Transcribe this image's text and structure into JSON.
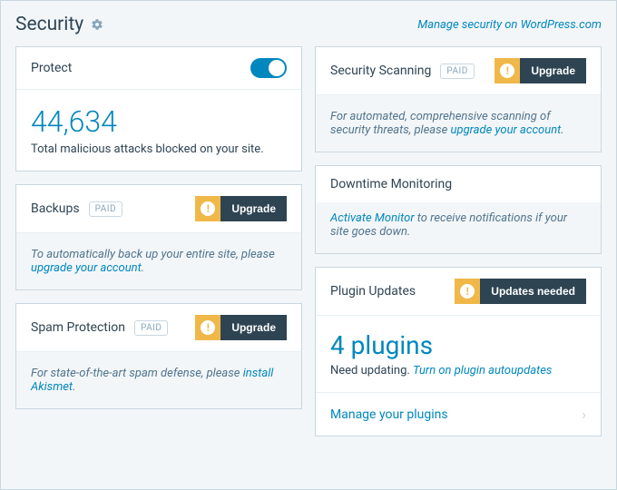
{
  "header": {
    "title": "Security",
    "manage_link": "Manage security on WordPress.com"
  },
  "cards": {
    "protect": {
      "title": "Protect",
      "count": "44,634",
      "caption": "Total malicious attacks blocked on your site."
    },
    "backups": {
      "title": "Backups",
      "badge": "PAID",
      "button": "Upgrade",
      "body_prefix": "To automatically back up your entire site, please ",
      "body_link": "upgrade your account",
      "body_suffix": "."
    },
    "spam": {
      "title": "Spam Protection",
      "badge": "PAID",
      "button": "Upgrade",
      "body_prefix": "For state-of-the-art spam defense, please ",
      "body_link": "install Akismet",
      "body_suffix": "."
    },
    "scanning": {
      "title": "Security Scanning",
      "badge": "PAID",
      "button": "Upgrade",
      "body_prefix": "For automated, comprehensive scanning of security threats, please ",
      "body_link": "upgrade your account",
      "body_suffix": "."
    },
    "downtime": {
      "title": "Downtime Monitoring",
      "body_link": "Activate Monitor",
      "body_suffix": " to receive notifications if your site goes down."
    },
    "plugins": {
      "title": "Plugin Updates",
      "button": "Updates needed",
      "count": "4 plugins",
      "caption_prefix": "Need updating. ",
      "caption_link": "Turn on plugin autoupdates",
      "footer": "Manage your plugins"
    }
  }
}
